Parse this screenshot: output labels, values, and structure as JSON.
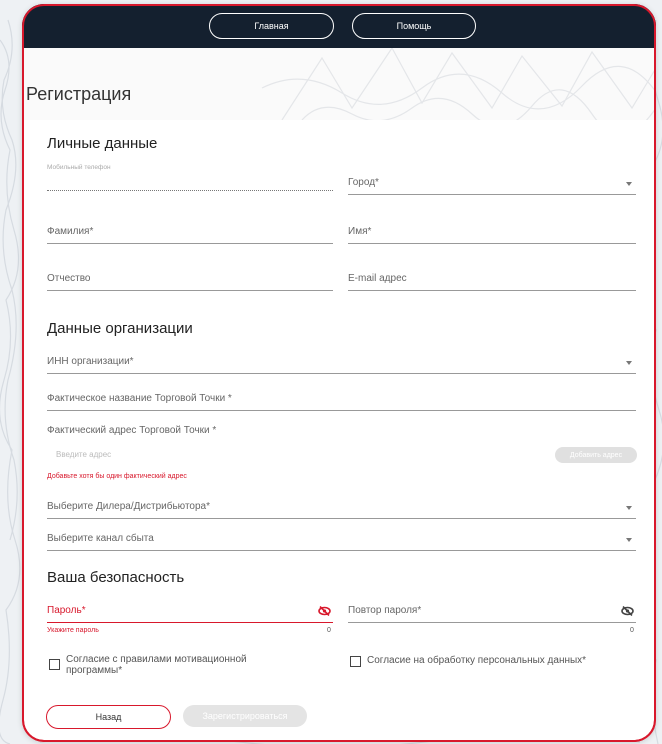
{
  "nav": {
    "home": "Главная",
    "help": "Помощь"
  },
  "page_title": "Регистрация",
  "personal": {
    "title": "Личные данные",
    "phone_label": "Мобильный телефон",
    "city": "Город*",
    "surname": "Фамилия*",
    "name": "Имя*",
    "patronymic": "Отчество",
    "email": "E-mail адрес"
  },
  "organization": {
    "title": "Данные организации",
    "inn": "ИНН организации*",
    "shop_name": "Фактическое название Торговой Точки *",
    "shop_address": "Фактический адрес Торговой Точки *",
    "address_placeholder": "Введите адрес",
    "add_address": "Добавить адрес",
    "address_error": "Добавьте хотя бы один фактический адрес",
    "dealer": "Выберите Дилера/Дистрибьютора*",
    "channel": "Выберите канал сбыта"
  },
  "security": {
    "title": "Ваша безопасность",
    "password": "Пароль*",
    "password_error": "Укажите пароль",
    "password_count": "0",
    "repeat": "Повтор пароля*",
    "repeat_count": "0"
  },
  "consents": {
    "rules": "Согласие с правилами мотивационной программы*",
    "personal_data": "Согласие на обработку персональных данных*"
  },
  "actions": {
    "back": "Назад",
    "register": "Зарегистрироваться"
  },
  "colors": {
    "accent": "#d8182c",
    "topbar": "#14202f"
  }
}
